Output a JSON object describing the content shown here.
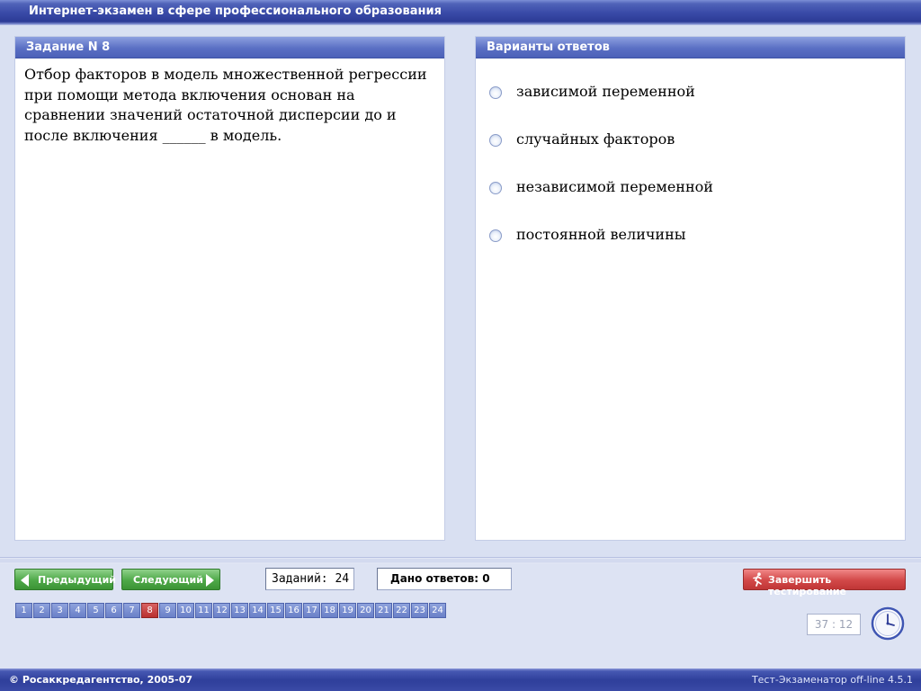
{
  "window": {
    "title": "Интернет-экзамен в сфере профессионального образования"
  },
  "task": {
    "header": "Задание N 8",
    "question": "Отбор факторов в модель множественной регрессии при помощи метода включения основан на сравнении значений остаточной дисперсии до и после включения ______ в модель."
  },
  "answers": {
    "header": "Варианты ответов",
    "options": [
      "зависимой переменной",
      "случайных факторов",
      "независимой переменной",
      "постоянной величины"
    ]
  },
  "navigation": {
    "prev_label": "Предыдущий",
    "next_label": "Следующий",
    "total_tasks": "Заданий: 24",
    "answered": "Дано ответов: 0",
    "finish_label": "Завершить тестирование",
    "current_page": 8,
    "pages": [
      "1",
      "2",
      "3",
      "4",
      "5",
      "6",
      "7",
      "8",
      "9",
      "10",
      "11",
      "12",
      "13",
      "14",
      "15",
      "16",
      "17",
      "18",
      "19",
      "20",
      "21",
      "22",
      "23",
      "24"
    ]
  },
  "timer": {
    "value": "37 : 12"
  },
  "footer": {
    "copyright": "© Росаккредагентство, 2005-07",
    "version": "Тест-Экзаменатор off-line 4.5.1"
  },
  "icons": {
    "prev": "arrow-left-icon",
    "next": "arrow-right-icon",
    "finish": "running-man-icon",
    "clock": "clock-icon"
  },
  "colors": {
    "title_bar": "#3a4ba8",
    "panel_header": "#5a6fc4",
    "nav_button": "#4ea848",
    "finish_button": "#d24848",
    "active_page": "#b93030"
  }
}
